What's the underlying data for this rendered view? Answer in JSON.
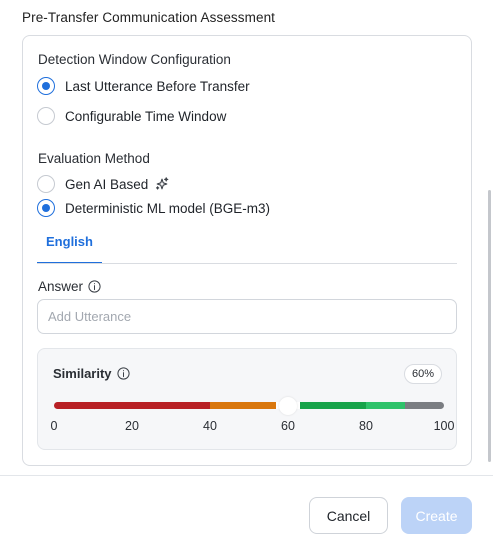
{
  "section": {
    "title": "Pre-Transfer Communication Assessment"
  },
  "detection": {
    "label": "Detection Window Configuration",
    "options": [
      {
        "label": "Last Utterance Before Transfer",
        "selected": true
      },
      {
        "label": "Configurable Time Window",
        "selected": false
      }
    ]
  },
  "evaluation": {
    "label": "Evaluation Method",
    "options": [
      {
        "label": "Gen AI Based",
        "selected": false,
        "icon": "sparkle-icon"
      },
      {
        "label": "Deterministic ML model (BGE-m3)",
        "selected": true
      }
    ]
  },
  "tabs": [
    {
      "label": "English",
      "active": true
    }
  ],
  "answer": {
    "label": "Answer",
    "info_icon": "info-icon",
    "input_value": "",
    "placeholder": "Add Utterance"
  },
  "similarity": {
    "label": "Similarity",
    "info_icon": "info-icon",
    "value_label": "60%",
    "value": 60,
    "min": 0,
    "max": 100,
    "ticks": [
      "0",
      "20",
      "40",
      "60",
      "80",
      "100"
    ],
    "segments": [
      {
        "from": 0,
        "to": 40,
        "color": "#b82025"
      },
      {
        "from": 40,
        "to": 57,
        "color": "#d9770d"
      },
      {
        "from": 57,
        "to": 63,
        "color": "#ffffff"
      },
      {
        "from": 63,
        "to": 80,
        "color": "#17a34a"
      },
      {
        "from": 80,
        "to": 90,
        "color": "#2ec26a"
      },
      {
        "from": 90,
        "to": 100,
        "color": "#7a7d82"
      }
    ]
  },
  "footer": {
    "cancel_label": "Cancel",
    "create_label": "Create"
  },
  "colors": {
    "accent": "#1f6fdc",
    "create_disabled_bg": "#bcd3f7"
  }
}
